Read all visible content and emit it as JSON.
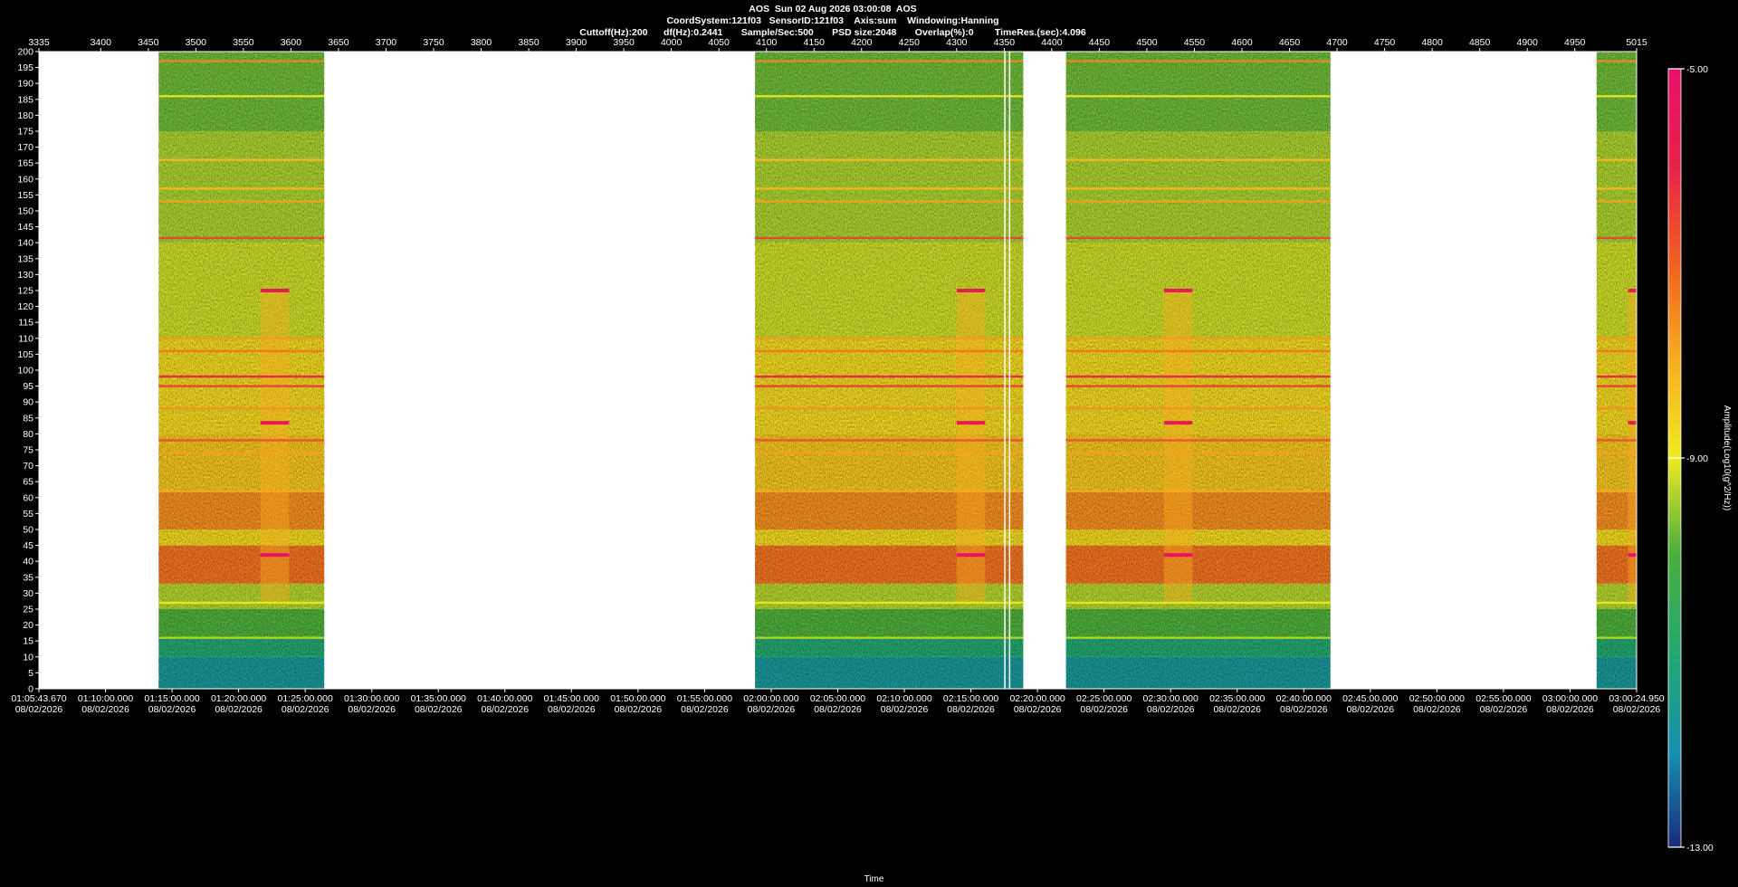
{
  "header": {
    "line1": "AOS  Sun 02 Aug 2026 03:00:08  AOS",
    "line2": "CoordSystem:121f03   SensorID:121f03    Axis:sum    Windowing:Hanning",
    "line3": "Cuttoff(Hz):200      df(Hz):0.2441       Sample/Sec:500       PSD size:2048       Overlap(%):0        TimeRes.(sec):4.096"
  },
  "chart_data": {
    "type": "heatmap",
    "title": "AOS  Sun 02 Aug 2026 03:00:08  AOS",
    "xlabel": "Time",
    "colorbar_label": "Amplitude(Log10(g^2/Hz))",
    "y_range": [
      0,
      200
    ],
    "y_ticks": [
      0,
      5,
      10,
      15,
      20,
      25,
      30,
      35,
      40,
      45,
      50,
      55,
      60,
      65,
      70,
      75,
      80,
      85,
      90,
      95,
      100,
      105,
      110,
      115,
      120,
      125,
      130,
      135,
      140,
      145,
      150,
      155,
      160,
      165,
      170,
      175,
      180,
      185,
      190,
      195,
      200
    ],
    "top_axis": {
      "range": [
        3335,
        5015
      ],
      "ticks": [
        3335,
        3400,
        3450,
        3500,
        3550,
        3600,
        3650,
        3700,
        3750,
        3800,
        3850,
        3900,
        3950,
        4000,
        4050,
        4100,
        4150,
        4200,
        4250,
        4300,
        4350,
        4400,
        4450,
        4500,
        4550,
        4600,
        4650,
        4700,
        4750,
        4800,
        4850,
        4900,
        4950,
        5015
      ]
    },
    "bottom_axis": {
      "ticks": [
        {
          "pos": 3335,
          "time": "01:05:43.670",
          "date": "08/02/2026"
        },
        {
          "pos": 3405,
          "time": "01:10:00.000",
          "date": "08/02/2026"
        },
        {
          "pos": 3475,
          "time": "01:15:00.000",
          "date": "08/02/2026"
        },
        {
          "pos": 3545,
          "time": "01:20:00.000",
          "date": "08/02/2026"
        },
        {
          "pos": 3615,
          "time": "01:25:00.000",
          "date": "08/02/2026"
        },
        {
          "pos": 3685,
          "time": "01:30:00.000",
          "date": "08/02/2026"
        },
        {
          "pos": 3755,
          "time": "01:35:00.000",
          "date": "08/02/2026"
        },
        {
          "pos": 3825,
          "time": "01:40:00.000",
          "date": "08/02/2026"
        },
        {
          "pos": 3895,
          "time": "01:45:00.000",
          "date": "08/02/2026"
        },
        {
          "pos": 3965,
          "time": "01:50:00.000",
          "date": "08/02/2026"
        },
        {
          "pos": 4035,
          "time": "01:55:00.000",
          "date": "08/02/2026"
        },
        {
          "pos": 4105,
          "time": "02:00:00.000",
          "date": "08/02/2026"
        },
        {
          "pos": 4175,
          "time": "02:05:00.000",
          "date": "08/02/2026"
        },
        {
          "pos": 4245,
          "time": "02:10:00.000",
          "date": "08/02/2026"
        },
        {
          "pos": 4315,
          "time": "02:15:00.000",
          "date": "08/02/2026"
        },
        {
          "pos": 4385,
          "time": "02:20:00.000",
          "date": "08/02/2026"
        },
        {
          "pos": 4455,
          "time": "02:25:00.000",
          "date": "08/02/2026"
        },
        {
          "pos": 4525,
          "time": "02:30:00.000",
          "date": "08/02/2026"
        },
        {
          "pos": 4595,
          "time": "02:35:00.000",
          "date": "08/02/2026"
        },
        {
          "pos": 4665,
          "time": "02:40:00.000",
          "date": "08/02/2026"
        },
        {
          "pos": 4735,
          "time": "02:45:00.000",
          "date": "08/02/2026"
        },
        {
          "pos": 4805,
          "time": "02:50:00.000",
          "date": "08/02/2026"
        },
        {
          "pos": 4875,
          "time": "02:55:00.000",
          "date": "08/02/2026"
        },
        {
          "pos": 4945,
          "time": "03:00:00.000",
          "date": "08/02/2026"
        },
        {
          "pos": 5015,
          "time": "03:00:24.950",
          "date": "08/02/2026"
        }
      ]
    },
    "colorbar": {
      "min": -13.0,
      "max": -5.0,
      "tick_labels": [
        {
          "value": -5.0,
          "label": "-5.00"
        },
        {
          "value": -9.0,
          "label": "-9.00"
        },
        {
          "value": -13.0,
          "label": "-13.00"
        }
      ],
      "colors": [
        "#1a2a7a",
        "#1590b0",
        "#22a870",
        "#4caf3c",
        "#a8d030",
        "#f0ea20",
        "#f8b020",
        "#f06020",
        "#e8204a",
        "#e8106a"
      ]
    },
    "segments": [
      {
        "start": 3461,
        "end": 3635,
        "sub_block": [
          3568,
          3598
        ]
      },
      {
        "start": 4088,
        "end": 4370,
        "sub_block": [
          4300,
          4330
        ]
      },
      {
        "start": 4415,
        "end": 4693,
        "sub_block": [
          4518,
          4548
        ]
      },
      {
        "start": 4973,
        "end": 5040,
        "sub_block": [
          5006,
          5036
        ]
      }
    ],
    "gap_lines": [
      4350,
      4355
    ],
    "spectral_bands": [
      {
        "freq_min": 0,
        "freq_max": 10,
        "level": -11.8
      },
      {
        "freq_min": 10,
        "freq_max": 16,
        "level": -11.2
      },
      {
        "freq_min": 16,
        "freq_max": 25,
        "level": -10.3
      },
      {
        "freq_min": 25,
        "freq_max": 33,
        "level": -9.3
      },
      {
        "freq_min": 33,
        "freq_max": 45,
        "level": -7.0
      },
      {
        "freq_min": 45,
        "freq_max": 50,
        "level": -8.3
      },
      {
        "freq_min": 50,
        "freq_max": 62,
        "level": -7.3
      },
      {
        "freq_min": 62,
        "freq_max": 80,
        "level": -8.0
      },
      {
        "freq_min": 80,
        "freq_max": 110,
        "level": -8.3
      },
      {
        "freq_min": 110,
        "freq_max": 140,
        "level": -9.0
      },
      {
        "freq_min": 140,
        "freq_max": 175,
        "level": -9.4
      },
      {
        "freq_min": 175,
        "freq_max": 200,
        "level": -10.0
      }
    ],
    "spectral_lines": [
      {
        "freq": 197,
        "level": -7.2
      },
      {
        "freq": 186,
        "level": -8.6
      },
      {
        "freq": 166,
        "level": -7.8
      },
      {
        "freq": 157,
        "level": -7.8
      },
      {
        "freq": 153,
        "level": -7.5
      },
      {
        "freq": 141.5,
        "level": -6.3
      },
      {
        "freq": 110,
        "level": -7.4
      },
      {
        "freq": 106,
        "level": -7.0
      },
      {
        "freq": 98,
        "level": -5.6
      },
      {
        "freq": 95,
        "level": -6.2
      },
      {
        "freq": 88,
        "level": -7.3
      },
      {
        "freq": 78,
        "level": -6.5
      },
      {
        "freq": 74,
        "level": -7.5
      },
      {
        "freq": 62,
        "level": -7.6
      },
      {
        "freq": 27,
        "level": -8.6
      },
      {
        "freq": 16,
        "level": -9.2
      }
    ],
    "block_lines": [
      {
        "freq": 125,
        "level": -5.6
      },
      {
        "freq": 83.5,
        "level": -5.5
      },
      {
        "freq": 42,
        "level": -5.2
      }
    ]
  }
}
